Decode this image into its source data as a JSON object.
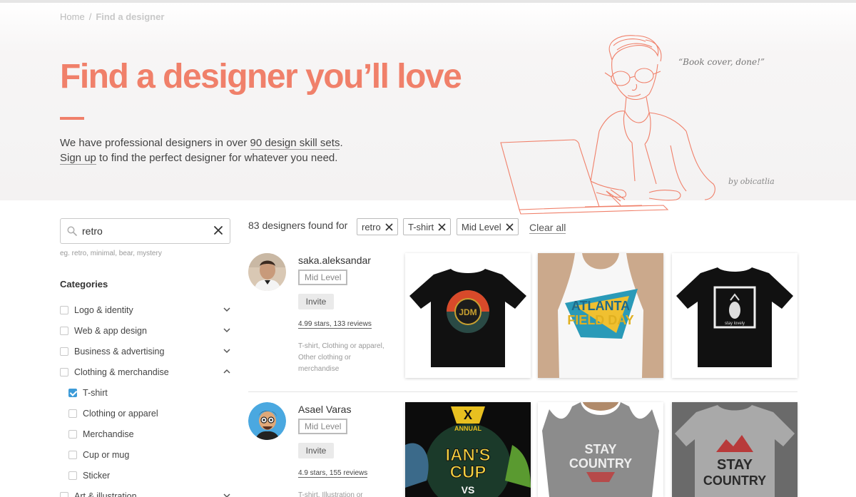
{
  "breadcrumb": {
    "home": "Home",
    "separator": "/",
    "current": "Find a designer"
  },
  "hero": {
    "title": "Find a designer you’ll love",
    "line1_prefix": "We have professional designers in over ",
    "line1_link": "90 design skill sets",
    "line1_suffix": ".",
    "line2_link": "Sign up",
    "line2_suffix": " to find the perfect designer for whatever you need.",
    "quote": "“Book cover, done!”",
    "credit": "by obicatlia"
  },
  "search": {
    "value": "retro",
    "hint": "eg. retro, minimal, bear, mystery",
    "icon": "search-icon"
  },
  "categories": {
    "title": "Categories",
    "items": [
      {
        "label": "Logo & identity",
        "checked": false,
        "sub": false,
        "chevron": "down"
      },
      {
        "label": "Web & app design",
        "checked": false,
        "sub": false,
        "chevron": "down"
      },
      {
        "label": "Business & advertising",
        "checked": false,
        "sub": false,
        "chevron": "down"
      },
      {
        "label": "Clothing & merchandise",
        "checked": false,
        "sub": false,
        "chevron": "up"
      },
      {
        "label": "T-shirt",
        "checked": true,
        "sub": true,
        "chevron": ""
      },
      {
        "label": "Clothing or apparel",
        "checked": false,
        "sub": true,
        "chevron": ""
      },
      {
        "label": "Merchandise",
        "checked": false,
        "sub": true,
        "chevron": ""
      },
      {
        "label": "Cup or mug",
        "checked": false,
        "sub": true,
        "chevron": ""
      },
      {
        "label": "Sticker",
        "checked": false,
        "sub": true,
        "chevron": ""
      },
      {
        "label": "Art & illustration",
        "checked": false,
        "sub": false,
        "chevron": "down"
      }
    ]
  },
  "results": {
    "found_text": "83 designers found for",
    "filters": [
      "retro",
      "T-shirt",
      "Mid Level"
    ],
    "clear_all": "Clear all"
  },
  "designers": [
    {
      "name": "saka.aleksandar",
      "level": "Mid Level",
      "invite": "Invite",
      "rating": "4.99 stars, 133 reviews",
      "skills": "T-shirt, Clothing or apparel, Other clothing or merchandise",
      "thumb_labels": [
        "JDM",
        "ATLANTA",
        "FIELD DAY",
        "stay lovely"
      ]
    },
    {
      "name": "Asael Varas",
      "level": "Mid Level",
      "invite": "Invite",
      "rating": "4.9 stars, 155 reviews",
      "skills": "T-shirt, Illustration or",
      "thumb_labels": [
        "X",
        "ANNUAL",
        "IAN'S",
        "CUP",
        "VS",
        "STAY",
        "COUNTRY",
        "STAY",
        "COUNTRY"
      ]
    }
  ],
  "colors": {
    "accent": "#f0806a",
    "check": "#3d9bd8"
  }
}
